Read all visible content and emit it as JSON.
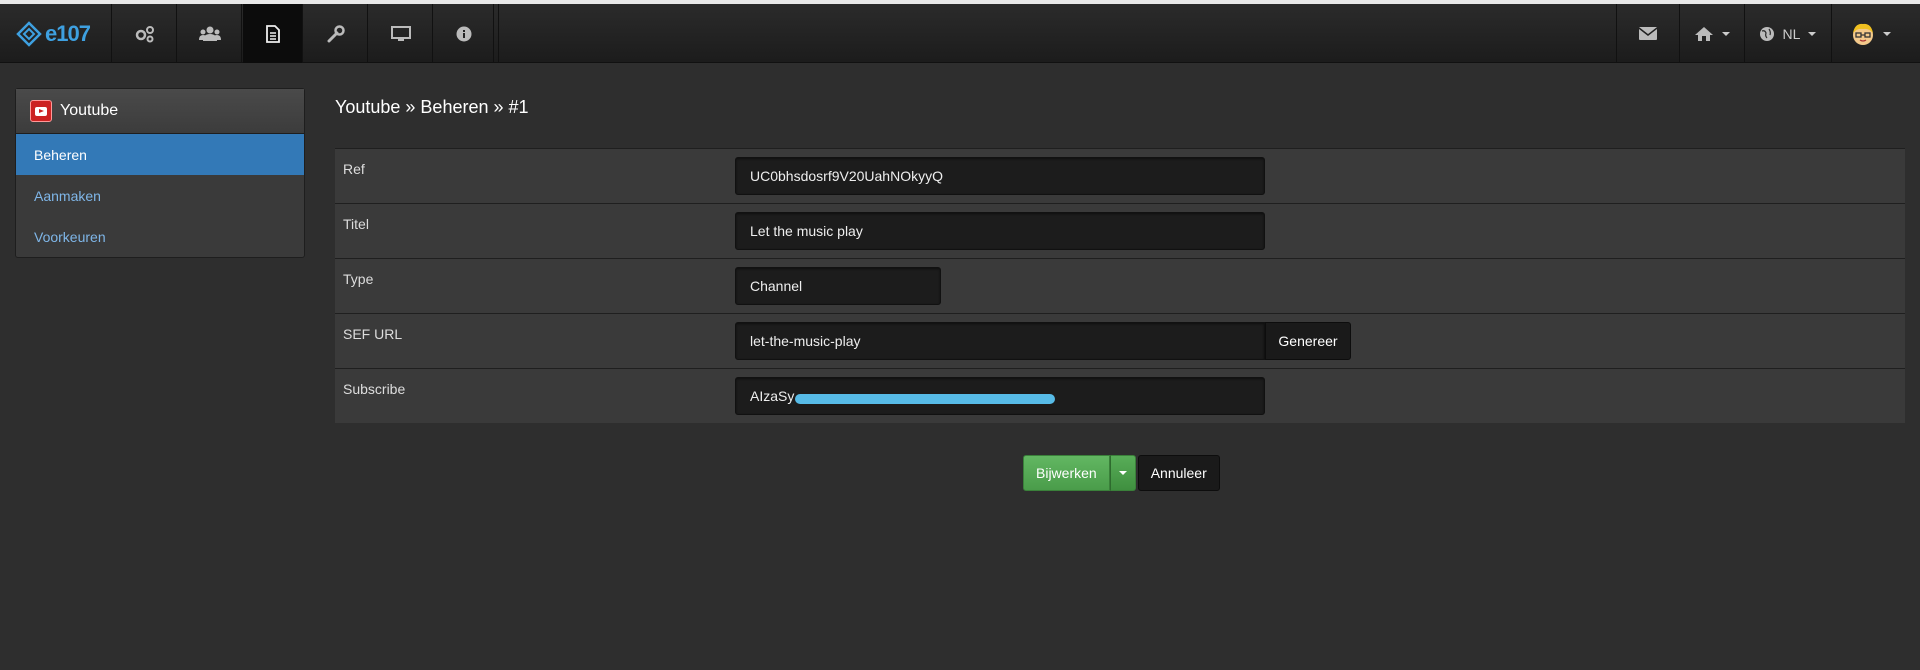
{
  "bookmarks": [
    "...",
    "...",
    "...",
    "...",
    "..."
  ],
  "navbar": {
    "brand": "e107",
    "items": [
      {
        "icon": "gears-icon",
        "name": "nav-settings"
      },
      {
        "icon": "users-icon",
        "name": "nav-users"
      },
      {
        "icon": "document-icon",
        "name": "nav-content",
        "active": true
      },
      {
        "icon": "wrench-icon",
        "name": "nav-tools"
      },
      {
        "icon": "monitor-icon",
        "name": "nav-appearance"
      },
      {
        "icon": "info-icon",
        "name": "nav-about"
      }
    ],
    "right": {
      "language": "NL"
    }
  },
  "sidebar": {
    "title": "Youtube",
    "items": [
      {
        "label": "Beheren",
        "active": true
      },
      {
        "label": "Aanmaken"
      },
      {
        "label": "Voorkeuren"
      }
    ]
  },
  "main": {
    "breadcrumb": "Youtube » Beheren » #1",
    "fields": {
      "ref": {
        "label": "Ref",
        "value": "UC0bhsdosrf9V20UahNOkyyQ"
      },
      "titel": {
        "label": "Titel",
        "value": "Let the music play"
      },
      "type": {
        "label": "Type",
        "value": "Channel"
      },
      "sef": {
        "label": "SEF URL",
        "value": "let-the-music-play",
        "button": "Genereer"
      },
      "subscribe": {
        "label": "Subscribe",
        "value": "AIzaSy"
      }
    },
    "actions": {
      "submit": "Bijwerken",
      "cancel": "Annuleer"
    }
  },
  "colors": {
    "accent": "#3379b7",
    "success": "#4a9c4a",
    "link": "#7fb6e8"
  }
}
